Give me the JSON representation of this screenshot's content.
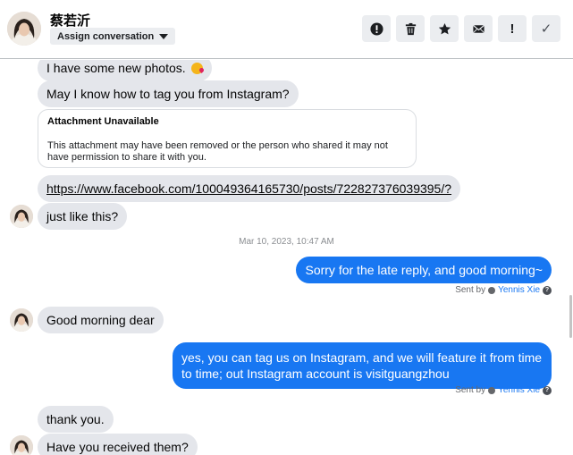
{
  "header": {
    "contact_name": "蔡若沂",
    "assign_label": "Assign conversation",
    "actions": {
      "flag": "!",
      "check": "✓"
    }
  },
  "messages": {
    "m1": "I have some new photos.",
    "m2": "May I know how to tag you from Instagram?",
    "attachment": {
      "title": "Attachment Unavailable",
      "body": "This attachment may have been removed or the person who shared it may not have permission to share it with you."
    },
    "link": "https://www.facebook.com/100049364165730/posts/722827376039395/?",
    "m3": "just like this?",
    "timestamp": "Mar 10, 2023, 10:47 AM",
    "reply1": "Sorry for the late reply, and good morning~",
    "m4": "Good morning dear",
    "reply2": "yes, you can tag us on Instagram, and we will feature it from time to time; out Instagram account is visitguangzhou",
    "m5": "thank you.",
    "m6": "Have you received them?"
  },
  "sent_by": {
    "prefix": "Sent by",
    "agent": "Yennis Xie",
    "help": "?"
  }
}
